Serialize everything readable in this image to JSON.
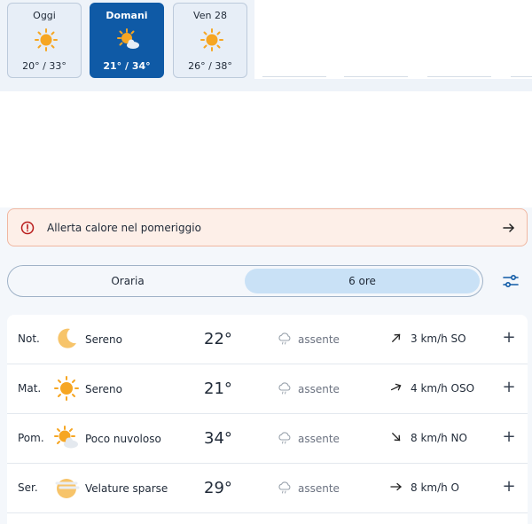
{
  "days": [
    {
      "name": "Oggi",
      "temps": "20° / 33°",
      "icon": "sun-icon"
    },
    {
      "name": "Domani",
      "temps": "21° / 34°",
      "icon": "sun-cloud-icon"
    },
    {
      "name": "Ven 28",
      "temps": "26° / 38°",
      "icon": "sun-icon"
    }
  ],
  "alert": {
    "text": "Allerta calore nel pomeriggio",
    "icon": "warning-circle-icon"
  },
  "toggle": {
    "option_hourly": "Oraria",
    "option_6h": "6 ore"
  },
  "periods": [
    {
      "label": "Not.",
      "condition": "Sereno",
      "temp": "22°",
      "rain": "assente",
      "wind": "3 km/h SO",
      "icon": "moon-icon"
    },
    {
      "label": "Mat.",
      "condition": "Sereno",
      "temp": "21°",
      "rain": "assente",
      "wind": "4 km/h OSO",
      "icon": "sun-icon"
    },
    {
      "label": "Pom.",
      "condition": "Poco nuvoloso",
      "temp": "34°",
      "rain": "assente",
      "wind": "8 km/h NO",
      "icon": "sun-cloud-icon"
    },
    {
      "label": "Ser.",
      "condition": "Velature sparse",
      "temp": "29°",
      "rain": "assente",
      "wind": "8 km/h O",
      "icon": "sun-haze-icon"
    }
  ],
  "colors": {
    "accent": "#0f5aa6",
    "sun": "#f6a623",
    "alert_bg": "#fdefe8",
    "toggle_active": "#c9e1f6"
  }
}
